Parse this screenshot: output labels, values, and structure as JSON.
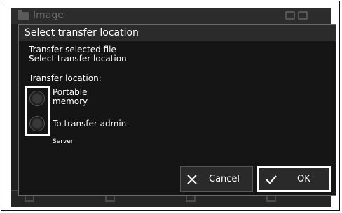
{
  "background": {
    "title": "Image"
  },
  "dialog": {
    "title": "Select transfer location",
    "message_line1": "Transfer selected file",
    "message_line2": "Select transfer location",
    "location_label": "Transfer location:",
    "option1_line1": "Portable",
    "option1_line2": "memory",
    "option2": "To transfer admin",
    "option2_sub": "Server",
    "cancel_label": "Cancel",
    "ok_label": "OK"
  },
  "icons": {
    "cancel": "close-icon",
    "ok": "checkmark-icon",
    "folder": "folder-icon"
  }
}
